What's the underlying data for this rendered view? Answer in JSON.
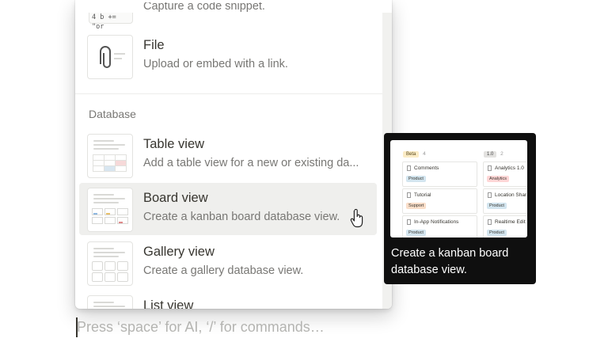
{
  "menu": {
    "code_item": {
      "thumb_text": "4 b += \"or",
      "description": "Capture a code snippet."
    },
    "items_top": [
      {
        "title": "File",
        "description": "Upload or embed with a link.",
        "icon": "paperclip-icon"
      }
    ],
    "section_label": "Database",
    "database_items": [
      {
        "title": "Table view",
        "description": "Add a table view for a new or existing da...",
        "icon": "table-thumbnail"
      },
      {
        "title": "Board view",
        "description": "Create a kanban board database view.",
        "icon": "board-thumbnail",
        "hovered": true
      },
      {
        "title": "Gallery view",
        "description": "Create a gallery database view.",
        "icon": "gallery-thumbnail"
      },
      {
        "title": "List view",
        "description": "",
        "icon": "list-thumbnail"
      }
    ]
  },
  "tooltip": {
    "text": "Create a kanban board database view.",
    "preview": {
      "columns": [
        {
          "label": "Beta",
          "count": "4",
          "color": "#fbecc6"
        },
        {
          "label": "1.0",
          "count": "2",
          "color": "#e3e2e0"
        }
      ],
      "cards": [
        {
          "title": "Comments",
          "tag": "Product",
          "tag_color": "#d3e5ef"
        },
        {
          "title": "Analytics 1.0",
          "tag": "Analytics",
          "tag_color": "#ffd6d6"
        },
        {
          "title": "Tutorial",
          "tag": "Support",
          "tag_color": "#fadec9"
        },
        {
          "title": "Location Shar",
          "tag": "Product",
          "tag_color": "#d3e5ef"
        },
        {
          "title": "In-App Notifications",
          "tag": "Product",
          "tag_color": "#d3e5ef"
        },
        {
          "title": "Realtime Edit",
          "tag": "Product",
          "tag_color": "#d3e5ef"
        }
      ]
    }
  },
  "editor": {
    "placeholder": "Press ‘space’ for AI, ‘/’ for commands…"
  },
  "colors": {
    "hover_bg": "#efefed",
    "tooltip_bg": "#0f0f0f",
    "text_primary": "#37352f",
    "text_secondary": "#787774"
  }
}
